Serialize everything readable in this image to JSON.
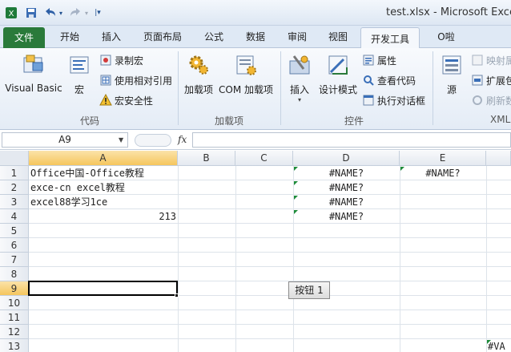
{
  "titlebar": {
    "app_icon": "excel-icon",
    "quick_access": [
      "save-icon",
      "undo-icon",
      "redo-icon",
      "customize-icon"
    ],
    "title": "test.xlsx - Microsoft Excel"
  },
  "tabs": [
    {
      "label": "文件"
    },
    {
      "label": "开始"
    },
    {
      "label": "插入"
    },
    {
      "label": "页面布局"
    },
    {
      "label": "公式"
    },
    {
      "label": "数据"
    },
    {
      "label": "审阅"
    },
    {
      "label": "视图"
    },
    {
      "label": "开发工具"
    },
    {
      "label": "O啦"
    }
  ],
  "ribbon": {
    "code": {
      "label": "代码",
      "visual_basic": "Visual Basic",
      "macro": "宏",
      "record_macro": "录制宏",
      "relative_ref": "使用相对引用",
      "macro_security": "宏安全性"
    },
    "addins": {
      "label": "加载项",
      "addins": "加载项",
      "com_addins": "COM 加载项"
    },
    "controls": {
      "label": "控件",
      "insert": "插入",
      "design_mode": "设计模式",
      "properties": "属性",
      "view_code": "查看代码",
      "run_dialog": "执行对话框"
    },
    "xml": {
      "label": "XML",
      "source": "源",
      "map_props": "映射属",
      "expansion": "扩展包",
      "refresh": "刷新数"
    }
  },
  "formula_bar": {
    "name_box": "A9",
    "fx": "fx",
    "value": ""
  },
  "grid": {
    "columns": [
      "A",
      "B",
      "C",
      "D",
      "E"
    ],
    "rows": [
      "1",
      "2",
      "3",
      "4",
      "5",
      "6",
      "7",
      "8",
      "9",
      "10",
      "11",
      "12",
      "13"
    ],
    "cells": {
      "A1": "Office中国-Office教程",
      "A2": "exce-cn excel教程",
      "A3": "excel88学习1ce",
      "A4": "213",
      "D1": "#NAME?",
      "D2": "#NAME?",
      "D3": "#NAME?",
      "D4": "#NAME?",
      "E1": "#NAME?",
      "F13": "#VA"
    },
    "button_label": "按钮 1",
    "selected_cell": "A9",
    "selected_column": "A",
    "selected_row": "9",
    "error_color": "#1e8c3a"
  }
}
